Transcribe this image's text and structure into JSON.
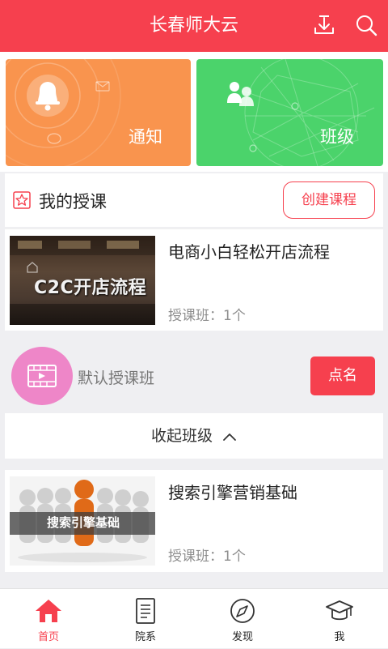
{
  "header": {
    "title": "长春师大云"
  },
  "tiles": [
    {
      "label": "通知"
    },
    {
      "label": "班级"
    }
  ],
  "my_courses": {
    "title": "我的授课",
    "create_button": "创建课程"
  },
  "courses": [
    {
      "name": "电商小白轻松开店流程",
      "thumb_text": "C2C开店流程",
      "meta": "授课班：1个"
    },
    {
      "name": "搜索引擎营销基础",
      "thumb_text": "搜索引擎基础",
      "meta": "授课班：1个"
    }
  ],
  "default_class": {
    "name": "默认授课班",
    "roll_call_button": "点名"
  },
  "collapse": {
    "label": "收起班级"
  },
  "tabbar": {
    "items": [
      {
        "label": "首页"
      },
      {
        "label": "院系"
      },
      {
        "label": "发现"
      },
      {
        "label": "我"
      }
    ]
  },
  "colors": {
    "accent": "#f6404e",
    "tile_notify": "#f9944e",
    "tile_class": "#4bd36b",
    "avatar": "#ee86c8"
  }
}
